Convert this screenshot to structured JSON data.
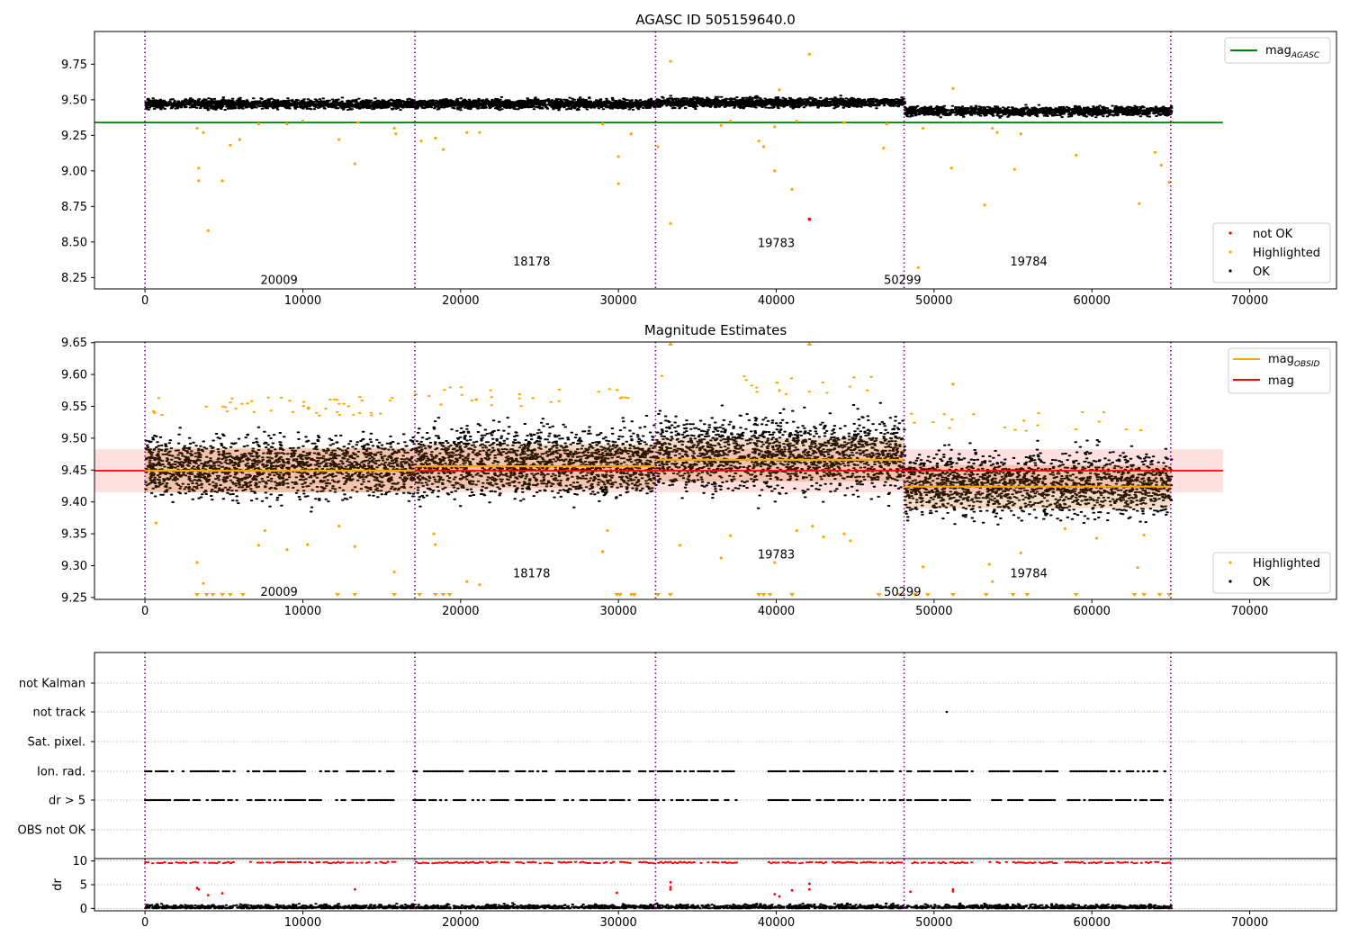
{
  "chart_data": [
    {
      "type": "scatter",
      "title": "AGASC ID 505159640.0",
      "xlim": [
        -3200,
        75500
      ],
      "ylim": [
        8.17,
        9.98
      ],
      "x_ticks": [
        0,
        10000,
        20000,
        30000,
        40000,
        50000,
        60000,
        70000
      ],
      "y_ticks": [
        8.25,
        8.5,
        8.75,
        9.0,
        9.25,
        9.5,
        9.75
      ],
      "vlines": [
        0,
        17100,
        32350,
        48100,
        65000
      ],
      "obsids": [
        {
          "label": "20009",
          "x": 8500,
          "y": 8.23
        },
        {
          "label": "18178",
          "x": 24500,
          "y": 8.36
        },
        {
          "label": "19783",
          "x": 40000,
          "y": 8.49
        },
        {
          "label": "50299",
          "x": 48000,
          "y": 8.23
        },
        {
          "label": "19784",
          "x": 56000,
          "y": 8.36
        }
      ],
      "series": [
        {
          "name": "mag$_{AGASC}$",
          "kind": "hline",
          "y": 9.34,
          "xmin": -3200,
          "xmax": 68300,
          "color": "#008000"
        },
        {
          "name": "not OK",
          "color": "#ff0000",
          "points": [
            [
              42100,
              8.66
            ]
          ]
        },
        {
          "name": "Highlighted",
          "color": "#ffa500",
          "points": [
            [
              3300,
              9.3
            ],
            [
              3400,
              9.02
            ],
            [
              3400,
              8.93
            ],
            [
              3700,
              9.27
            ],
            [
              4000,
              8.58
            ],
            [
              4900,
              8.93
            ],
            [
              5400,
              9.18
            ],
            [
              6000,
              9.22
            ],
            [
              7200,
              9.33
            ],
            [
              9000,
              9.33
            ],
            [
              10000,
              9.35
            ],
            [
              12300,
              9.22
            ],
            [
              13300,
              9.05
            ],
            [
              13500,
              9.34
            ],
            [
              15800,
              9.3
            ],
            [
              15900,
              9.26
            ],
            [
              17500,
              9.21
            ],
            [
              18400,
              9.23
            ],
            [
              18900,
              9.15
            ],
            [
              20400,
              9.27
            ],
            [
              21200,
              9.27
            ],
            [
              29000,
              9.33
            ],
            [
              30000,
              9.1
            ],
            [
              30000,
              8.91
            ],
            [
              30800,
              9.26
            ],
            [
              32500,
              9.17
            ],
            [
              33300,
              9.77
            ],
            [
              33300,
              8.63
            ],
            [
              36500,
              9.32
            ],
            [
              37100,
              9.35
            ],
            [
              38900,
              9.21
            ],
            [
              39200,
              9.17
            ],
            [
              39900,
              9.0
            ],
            [
              39900,
              9.31
            ],
            [
              40200,
              9.57
            ],
            [
              41000,
              8.87
            ],
            [
              41300,
              9.35
            ],
            [
              42100,
              9.82
            ],
            [
              44300,
              9.34
            ],
            [
              46800,
              9.16
            ],
            [
              47000,
              9.33
            ],
            [
              49000,
              8.32
            ],
            [
              49300,
              9.3
            ],
            [
              51100,
              9.02
            ],
            [
              51200,
              9.58
            ],
            [
              53200,
              8.76
            ],
            [
              53700,
              9.3
            ],
            [
              54000,
              9.27
            ],
            [
              55100,
              9.01
            ],
            [
              55500,
              9.26
            ],
            [
              59000,
              9.11
            ],
            [
              63000,
              8.77
            ],
            [
              64000,
              9.13
            ],
            [
              64400,
              9.04
            ],
            [
              64900,
              8.92
            ]
          ]
        },
        {
          "name": "OK",
          "color": "#000000",
          "bands": [
            [
              0,
              17100,
              9.47,
              0.035
            ],
            [
              17100,
              32350,
              9.47,
              0.035
            ],
            [
              32350,
              48100,
              9.48,
              0.035
            ],
            [
              48100,
              65000,
              9.42,
              0.035
            ]
          ]
        }
      ],
      "legend_upper": "top-right",
      "legend_lower": "bottom-right"
    },
    {
      "type": "scatter",
      "title": "Magnitude Estimates",
      "xlim": [
        -3200,
        75500
      ],
      "ylim": [
        9.247,
        9.651
      ],
      "x_ticks": [
        0,
        10000,
        20000,
        30000,
        40000,
        50000,
        60000,
        70000
      ],
      "y_ticks": [
        9.25,
        9.3,
        9.35,
        9.4,
        9.45,
        9.5,
        9.55,
        9.6,
        9.65
      ],
      "vlines": [
        0,
        17100,
        32350,
        48100,
        65000
      ],
      "obsids": [
        {
          "label": "20009",
          "x": 8500,
          "y": 9.258
        },
        {
          "label": "18178",
          "x": 24500,
          "y": 9.287
        },
        {
          "label": "19783",
          "x": 40000,
          "y": 9.317
        },
        {
          "label": "50299",
          "x": 48000,
          "y": 9.258
        },
        {
          "label": "19784",
          "x": 56000,
          "y": 9.287
        }
      ],
      "mag": {
        "y": 9.449,
        "band": [
          9.415,
          9.483
        ],
        "xmin": -3200,
        "xmax": 68300,
        "color": "#ff0000"
      },
      "mag_obsid": [
        {
          "x0": 0,
          "x1": 17100,
          "y": 9.449,
          "lo": 9.415,
          "hi": 9.485
        },
        {
          "x0": 17100,
          "x1": 32350,
          "y": 9.456,
          "lo": 9.422,
          "hi": 9.49
        },
        {
          "x0": 32350,
          "x1": 48100,
          "y": 9.466,
          "lo": 9.432,
          "hi": 9.5
        },
        {
          "x0": 48100,
          "x1": 65000,
          "y": 9.424,
          "lo": 9.39,
          "hi": 9.458
        }
      ],
      "series": [
        {
          "name": "mag$_{OBSID}$",
          "kind": "segments",
          "color": "#ffa500"
        },
        {
          "name": "mag",
          "kind": "hline",
          "color": "#ff0000"
        },
        {
          "name": "Highlighted",
          "color": "#ffa500",
          "points": [
            [
              700,
              9.367
            ],
            [
              3300,
              9.305
            ],
            [
              3700,
              9.272
            ],
            [
              7200,
              9.332
            ],
            [
              7600,
              9.355
            ],
            [
              9000,
              9.325
            ],
            [
              10300,
              9.333
            ],
            [
              12300,
              9.362
            ],
            [
              13300,
              9.33
            ],
            [
              15800,
              9.29
            ],
            [
              18400,
              9.333
            ],
            [
              18300,
              9.35
            ],
            [
              20400,
              9.275
            ],
            [
              21200,
              9.27
            ],
            [
              29000,
              9.322
            ],
            [
              29300,
              9.355
            ],
            [
              30800,
              9.255
            ],
            [
              33900,
              9.332
            ],
            [
              36500,
              9.312
            ],
            [
              37100,
              9.347
            ],
            [
              39900,
              9.305
            ],
            [
              40200,
              9.575
            ],
            [
              41300,
              9.355
            ],
            [
              42300,
              9.362
            ],
            [
              43000,
              9.345
            ],
            [
              44300,
              9.35
            ],
            [
              44700,
              9.339
            ],
            [
              49300,
              9.298
            ],
            [
              51200,
              9.585
            ],
            [
              53500,
              9.302
            ],
            [
              53700,
              9.275
            ],
            [
              55500,
              9.32
            ],
            [
              58300,
              9.358
            ],
            [
              60300,
              9.343
            ],
            [
              62900,
              9.297
            ],
            [
              63300,
              9.348
            ]
          ],
          "clipped_low": [
            3300,
            3900,
            4300,
            4900,
            5400,
            6200,
            12200,
            13300,
            15800,
            17400,
            18400,
            18900,
            19300,
            29900,
            30100,
            31000,
            32500,
            33300,
            38900,
            39200,
            39600,
            41000,
            46500,
            47800,
            48800,
            49600,
            51200,
            53300,
            55000,
            55900,
            59000,
            62700,
            63300,
            64300,
            64900
          ],
          "clipped_high": [
            33300,
            42100
          ]
        },
        {
          "name": "OK",
          "color": "#000000",
          "bands": [
            [
              0,
              17100,
              9.455,
              0.05
            ],
            [
              17100,
              32350,
              9.462,
              0.055
            ],
            [
              32350,
              48100,
              9.475,
              0.058
            ],
            [
              48100,
              65000,
              9.428,
              0.052
            ]
          ]
        }
      ],
      "legend_upper": "top-right",
      "legend_lower": "bottom-right"
    },
    {
      "type": "scatter",
      "xlim": [
        -3200,
        75500
      ],
      "categories": [
        "not Kalman",
        "not track",
        "Sat. pixel.",
        "Ion. rad.",
        "dr > 5",
        "OBS not OK"
      ],
      "vlines": [
        0,
        17100,
        32350,
        48100,
        65000
      ],
      "flag_points": [
        {
          "category": "not track",
          "x": [
            50800
          ]
        },
        {
          "category": "Ion. rad.",
          "segments": [
            [
              0,
              5800
            ],
            [
              6500,
              15800
            ],
            [
              17000,
              23000
            ],
            [
              23500,
              30800
            ],
            [
              31300,
              37500
            ],
            [
              39500,
              48100
            ],
            [
              48300,
              52500
            ],
            [
              53500,
              57800
            ],
            [
              58300,
              65000
            ]
          ]
        },
        {
          "category": "dr > 5",
          "segments": [
            [
              0,
              5800
            ],
            [
              6500,
              15800
            ],
            [
              17000,
              23000
            ],
            [
              23500,
              30800
            ],
            [
              31300,
              37500
            ],
            [
              39500,
              48100
            ],
            [
              48300,
              52500
            ],
            [
              53500,
              57800
            ],
            [
              58300,
              65000
            ]
          ]
        }
      ],
      "dr": {
        "ylabel": "dr",
        "ylim": [
          -0.5,
          10.5
        ],
        "y_ticks": [
          0,
          5,
          10
        ],
        "x_ticks": [
          0,
          10000,
          20000,
          30000,
          40000,
          50000,
          60000,
          70000
        ],
        "ok_band": [
          0.0,
          1.3
        ],
        "red_band_y": 9.8,
        "red_points": [
          [
            3300,
            4.3
          ],
          [
            3400,
            4.0
          ],
          [
            4000,
            2.8
          ],
          [
            4900,
            3.2
          ],
          [
            13300,
            4.0
          ],
          [
            29900,
            3.3
          ],
          [
            33300,
            5.5
          ],
          [
            33300,
            4.5
          ],
          [
            33300,
            4.0
          ],
          [
            39900,
            3.0
          ],
          [
            40200,
            2.5
          ],
          [
            41000,
            3.8
          ],
          [
            42100,
            5.2
          ],
          [
            42100,
            4.0
          ],
          [
            48500,
            3.5
          ],
          [
            51200,
            4.0
          ],
          [
            51200,
            3.6
          ]
        ]
      }
    }
  ]
}
